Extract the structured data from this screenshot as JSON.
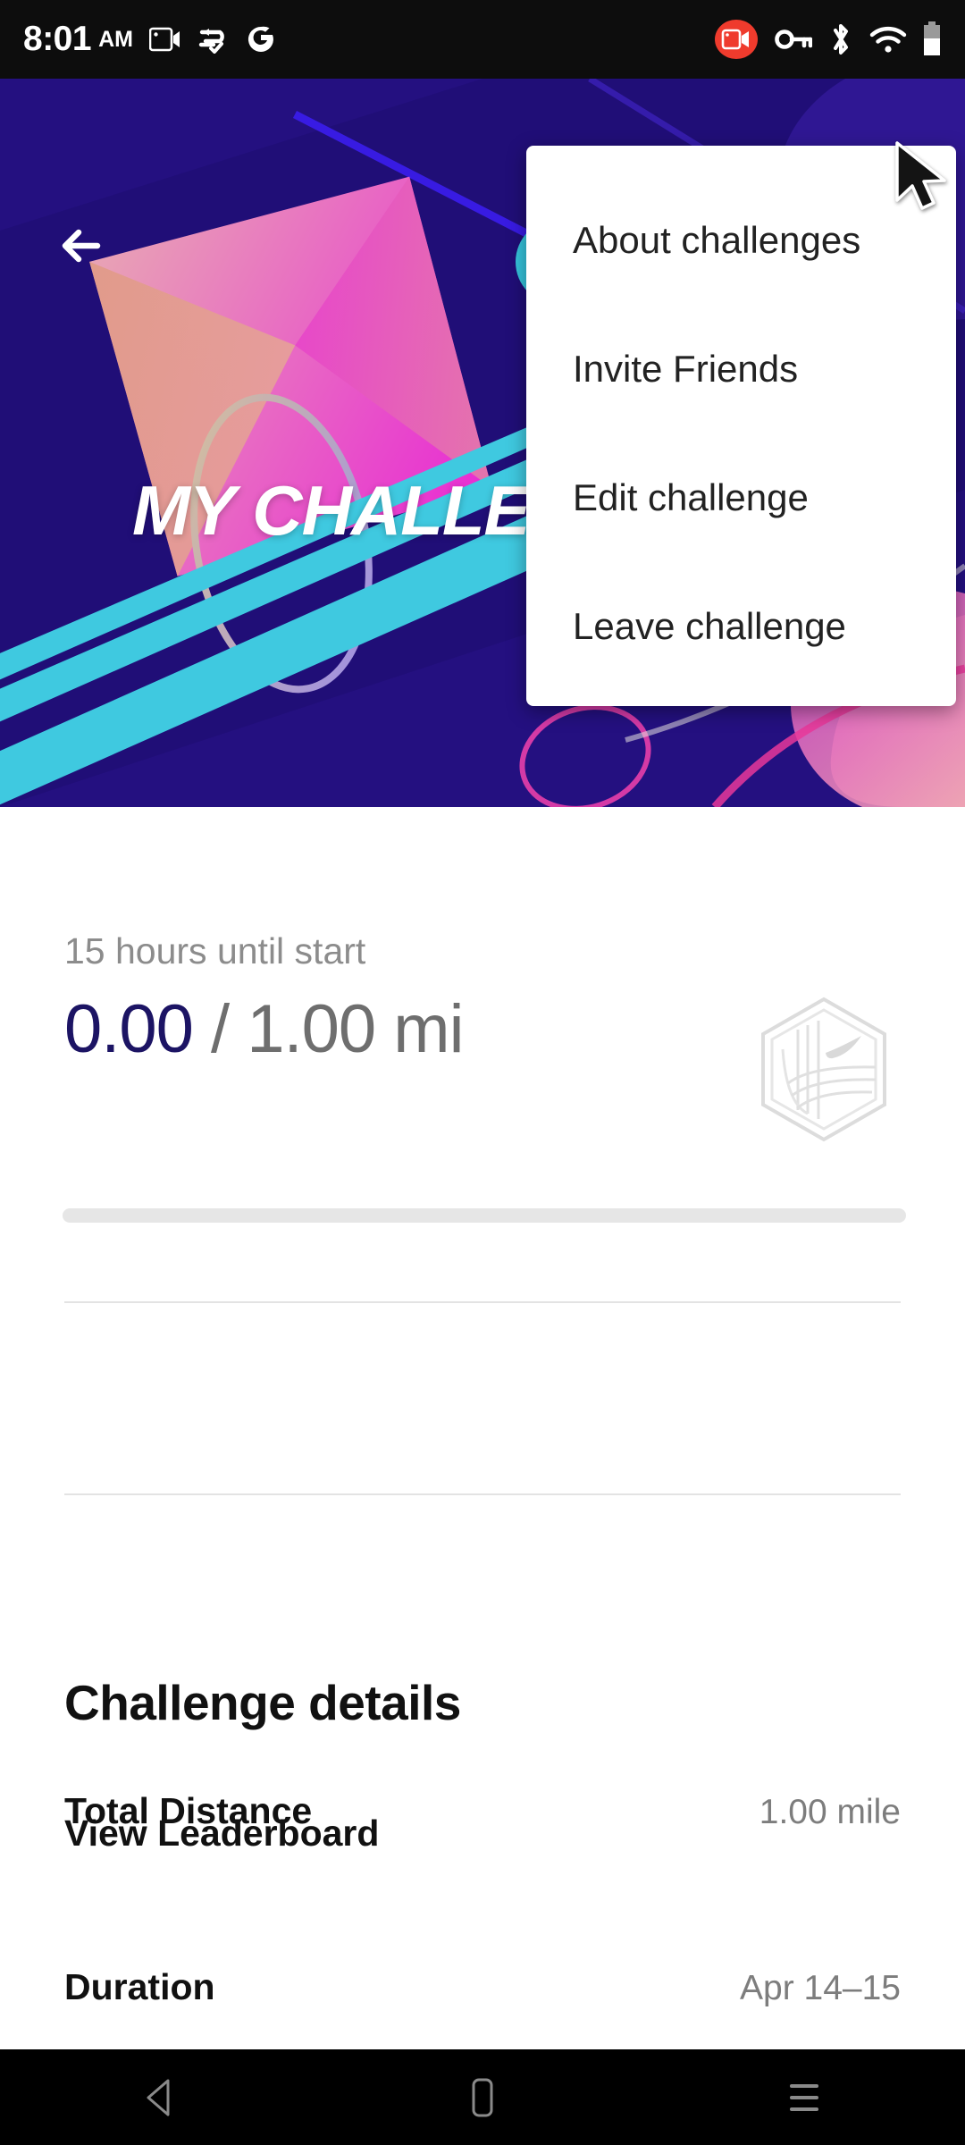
{
  "status_bar": {
    "time": "8:01",
    "ampm": "AM",
    "left_icons": [
      "screen-record-icon",
      "data-saver-icon",
      "google-icon"
    ],
    "right_icons": [
      "screen-record-active-icon",
      "vpn-key-icon",
      "bluetooth-icon",
      "wifi-icon",
      "battery-icon"
    ],
    "record_badge_color": "#ef3b2d"
  },
  "hero": {
    "title": "MY CHALLENGE",
    "back_label": "back-arrow",
    "overflow_label": "overflow-menu",
    "colors": {
      "background": "#241080",
      "deep_purple": "#1b0a66",
      "cyan": "#3fc9e0",
      "magenta": "#e02fd0",
      "pink": "#e06bb8",
      "peach": "#e3a18f",
      "blue_line": "#3218e0"
    }
  },
  "menu": {
    "items": [
      {
        "label": "About challenges"
      },
      {
        "label": "Invite Friends"
      },
      {
        "label": "Edit challenge"
      },
      {
        "label": "Leave challenge"
      }
    ]
  },
  "progress_card": {
    "countdown": "15 hours until start",
    "current_distance": "0.00",
    "separator_and_goal": " / 1.00 mi",
    "progress_percent": 0,
    "badge": "nike-hex-badge-icon",
    "current_color": "#1c1464",
    "goal_color": "#6e6e6e"
  },
  "leaderboard": {
    "label": "View Leaderboard"
  },
  "details": {
    "title": "Challenge details",
    "rows": [
      {
        "label": "Total Distance",
        "value": "1.00 mile"
      },
      {
        "label": "Duration",
        "value": "Apr 14–15"
      }
    ]
  },
  "navbar": {
    "back": "nav-back-icon",
    "home": "nav-home-icon",
    "recents": "nav-recents-icon"
  }
}
